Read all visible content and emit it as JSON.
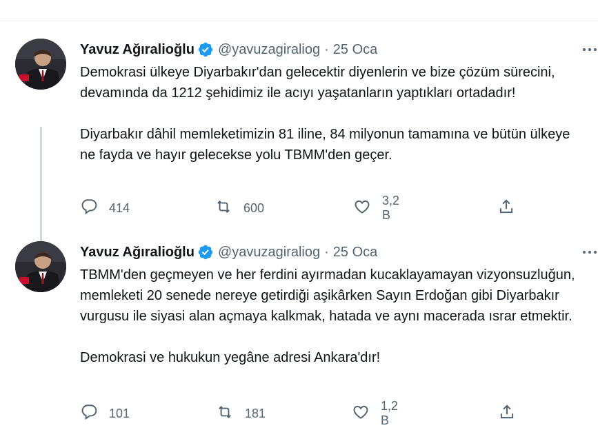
{
  "author": {
    "name": "Yavuz Ağıralioğlu",
    "handle": "@yavuzagiraliog",
    "separator": "·"
  },
  "colors": {
    "verified": "#1d9bf0",
    "muted": "#536471",
    "thread_line": "#cfd9de"
  },
  "icons": {
    "reply": "reply-icon",
    "retweet": "retweet-icon",
    "like": "heart-icon",
    "share": "share-icon",
    "more": "more-icon",
    "verified": "verified-badge-icon"
  },
  "tweets": [
    {
      "date": "25 Oca",
      "paragraphs": [
        "Demokrasi ülkeye Diyarbakır'dan gelecektir diyenlerin ve bize çözüm sürecini, devamında da 1212 şehidimiz ile acıyı yaşatanların yaptıkları ortadadır!",
        "Diyarbakır dâhil memleketimizin 81 iline, 84 milyonun tamamına ve bütün ülkeye ne fayda ve hayır gelecekse yolu TBMM'den geçer."
      ],
      "replies": "414",
      "retweets": "600",
      "likes": "3,2 B"
    },
    {
      "date": "25 Oca",
      "paragraphs": [
        "TBMM'den geçmeyen ve her ferdini ayırmadan kucaklayamayan vizyonsuzluğun, memleketi 20 senede nereye getirdiği aşikârken Sayın Erdoğan gibi Diyarbakır vurgusu ile siyasi alan açmaya kalkmak, hatada ve aynı macerada ısrar etmektir.",
        "Demokrasi ve hukukun yegâne adresi Ankara'dır!"
      ],
      "replies": "101",
      "retweets": "181",
      "likes": "1,2 B"
    }
  ]
}
